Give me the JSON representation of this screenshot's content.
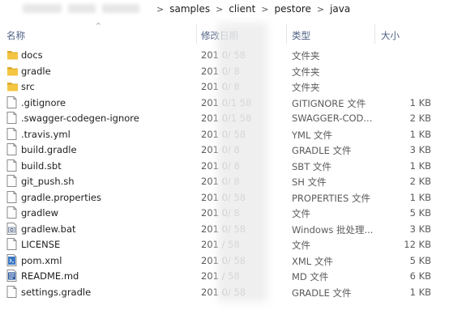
{
  "breadcrumb": {
    "items": [
      "samples",
      "client",
      "pestore",
      "java"
    ],
    "separator": ">"
  },
  "columns": {
    "name": "名称",
    "date": "修改日期",
    "type": "类型",
    "size": "大小"
  },
  "files": [
    {
      "name": "docs",
      "date": "201   0/        58",
      "type": "文件夹",
      "size": "",
      "icon": "folder-icon"
    },
    {
      "name": "gradle",
      "date": "201   0/        8",
      "type": "文件夹",
      "size": "",
      "icon": "folder-icon"
    },
    {
      "name": "src",
      "date": "201   0/        8",
      "type": "文件夹",
      "size": "",
      "icon": "folder-icon"
    },
    {
      "name": ".gitignore",
      "date": "201   0/1      58",
      "type": "GITIGNORE 文件",
      "size": "1 KB",
      "icon": "file-icon"
    },
    {
      "name": ".swagger-codegen-ignore",
      "date": "201   0/1      58",
      "type": "SWAGGER-COD...",
      "size": "2 KB",
      "icon": "file-icon"
    },
    {
      "name": ".travis.yml",
      "date": "201   0/       58",
      "type": "YML 文件",
      "size": "1 KB",
      "icon": "file-icon"
    },
    {
      "name": "build.gradle",
      "date": "201   0/        8",
      "type": "GRADLE 文件",
      "size": "3 KB",
      "icon": "file-icon"
    },
    {
      "name": "build.sbt",
      "date": "201   0/       8",
      "type": "SBT 文件",
      "size": "1 KB",
      "icon": "file-icon"
    },
    {
      "name": "git_push.sh",
      "date": "201   0/       8",
      "type": "SH 文件",
      "size": "2 KB",
      "icon": "file-icon"
    },
    {
      "name": "gradle.properties",
      "date": "201   0/        58",
      "type": "PROPERTIES 文件",
      "size": "1 KB",
      "icon": "file-icon"
    },
    {
      "name": "gradlew",
      "date": "201   0/        8",
      "type": "文件",
      "size": "5 KB",
      "icon": "file-icon"
    },
    {
      "name": "gradlew.bat",
      "date": "201   0/        58",
      "type": "Windows 批处理...",
      "size": "3 KB",
      "icon": "batch-file-icon"
    },
    {
      "name": "LICENSE",
      "date": "201   /        58",
      "type": "文件",
      "size": "12 KB",
      "icon": "file-icon"
    },
    {
      "name": "pom.xml",
      "date": "201   0/        58",
      "type": "XML 文件",
      "size": "5 KB",
      "icon": "xml-file-icon"
    },
    {
      "name": "README.md",
      "date": "201   /        58",
      "type": "MD 文件",
      "size": "6 KB",
      "icon": "markdown-file-icon"
    },
    {
      "name": "settings.gradle",
      "date": "201   0/        58",
      "type": "GRADLE 文件",
      "size": "1 KB",
      "icon": "file-icon"
    }
  ],
  "colors": {
    "header_text": "#4d6082",
    "folder": "#f4c542",
    "folder_dark": "#dcaa2a"
  }
}
